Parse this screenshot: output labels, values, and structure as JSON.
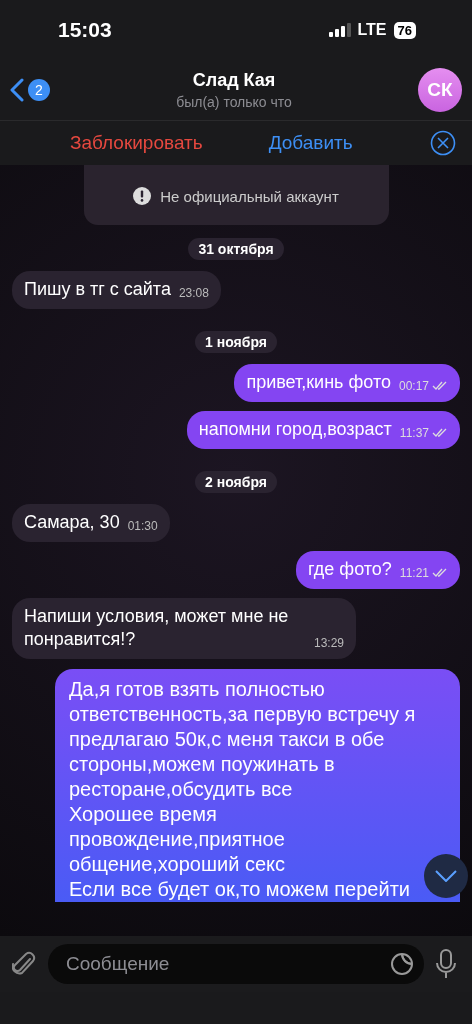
{
  "status_bar": {
    "time": "15:03",
    "network": "LTE",
    "battery": "76"
  },
  "header": {
    "back_badge": "2",
    "title": "Слад Кая",
    "subtitle": "был(а) только что",
    "avatar_initials": "СК"
  },
  "action_bar": {
    "block": "Заблокировать",
    "add": "Добавить"
  },
  "info_card": {
    "notice": "Не официальный аккаунт"
  },
  "messages": [
    {
      "kind": "date",
      "text": "31 октября"
    },
    {
      "kind": "in",
      "text": "Пишу в тг с сайта",
      "time": "23:08"
    },
    {
      "kind": "date",
      "text": "1 ноября"
    },
    {
      "kind": "out",
      "text": "привет,кинь фото",
      "time": "00:17",
      "read": true
    },
    {
      "kind": "out",
      "text": "напомни город,возраст",
      "time": "11:37",
      "read": true
    },
    {
      "kind": "date",
      "text": "2 ноября"
    },
    {
      "kind": "in",
      "text": "Самара, 30",
      "time": "01:30"
    },
    {
      "kind": "out",
      "text": "где фото?",
      "time": "11:21",
      "read": true
    },
    {
      "kind": "in",
      "text": "Напиши условия, может мне не понравится!?",
      "time": "13:29"
    },
    {
      "kind": "out",
      "text": "Да,я готов взять полностью ответственность,за первую встречу я предлагаю 50к,с меня такси в обе стороны,можем поужинать в ресторане,обсудить все\nХорошее время провождение,приятное общение,хороший секс\nЕсли все будет ок,то можем перейти"
    }
  ],
  "composer": {
    "placeholder": "Сообщение"
  }
}
